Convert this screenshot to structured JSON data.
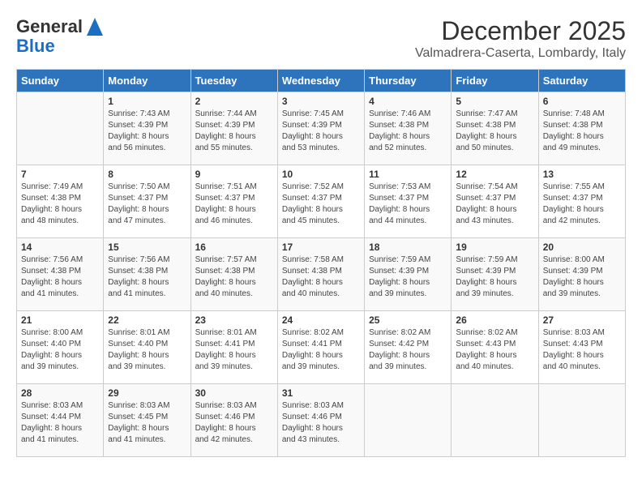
{
  "header": {
    "logo_general": "General",
    "logo_blue": "Blue",
    "month": "December 2025",
    "location": "Valmadrera-Caserta, Lombardy, Italy"
  },
  "days_of_week": [
    "Sunday",
    "Monday",
    "Tuesday",
    "Wednesday",
    "Thursday",
    "Friday",
    "Saturday"
  ],
  "weeks": [
    [
      {
        "day": "",
        "info": ""
      },
      {
        "day": "1",
        "info": "Sunrise: 7:43 AM\nSunset: 4:39 PM\nDaylight: 8 hours\nand 56 minutes."
      },
      {
        "day": "2",
        "info": "Sunrise: 7:44 AM\nSunset: 4:39 PM\nDaylight: 8 hours\nand 55 minutes."
      },
      {
        "day": "3",
        "info": "Sunrise: 7:45 AM\nSunset: 4:39 PM\nDaylight: 8 hours\nand 53 minutes."
      },
      {
        "day": "4",
        "info": "Sunrise: 7:46 AM\nSunset: 4:38 PM\nDaylight: 8 hours\nand 52 minutes."
      },
      {
        "day": "5",
        "info": "Sunrise: 7:47 AM\nSunset: 4:38 PM\nDaylight: 8 hours\nand 50 minutes."
      },
      {
        "day": "6",
        "info": "Sunrise: 7:48 AM\nSunset: 4:38 PM\nDaylight: 8 hours\nand 49 minutes."
      }
    ],
    [
      {
        "day": "7",
        "info": "Sunrise: 7:49 AM\nSunset: 4:38 PM\nDaylight: 8 hours\nand 48 minutes."
      },
      {
        "day": "8",
        "info": "Sunrise: 7:50 AM\nSunset: 4:37 PM\nDaylight: 8 hours\nand 47 minutes."
      },
      {
        "day": "9",
        "info": "Sunrise: 7:51 AM\nSunset: 4:37 PM\nDaylight: 8 hours\nand 46 minutes."
      },
      {
        "day": "10",
        "info": "Sunrise: 7:52 AM\nSunset: 4:37 PM\nDaylight: 8 hours\nand 45 minutes."
      },
      {
        "day": "11",
        "info": "Sunrise: 7:53 AM\nSunset: 4:37 PM\nDaylight: 8 hours\nand 44 minutes."
      },
      {
        "day": "12",
        "info": "Sunrise: 7:54 AM\nSunset: 4:37 PM\nDaylight: 8 hours\nand 43 minutes."
      },
      {
        "day": "13",
        "info": "Sunrise: 7:55 AM\nSunset: 4:37 PM\nDaylight: 8 hours\nand 42 minutes."
      }
    ],
    [
      {
        "day": "14",
        "info": "Sunrise: 7:56 AM\nSunset: 4:38 PM\nDaylight: 8 hours\nand 41 minutes."
      },
      {
        "day": "15",
        "info": "Sunrise: 7:56 AM\nSunset: 4:38 PM\nDaylight: 8 hours\nand 41 minutes."
      },
      {
        "day": "16",
        "info": "Sunrise: 7:57 AM\nSunset: 4:38 PM\nDaylight: 8 hours\nand 40 minutes."
      },
      {
        "day": "17",
        "info": "Sunrise: 7:58 AM\nSunset: 4:38 PM\nDaylight: 8 hours\nand 40 minutes."
      },
      {
        "day": "18",
        "info": "Sunrise: 7:59 AM\nSunset: 4:39 PM\nDaylight: 8 hours\nand 39 minutes."
      },
      {
        "day": "19",
        "info": "Sunrise: 7:59 AM\nSunset: 4:39 PM\nDaylight: 8 hours\nand 39 minutes."
      },
      {
        "day": "20",
        "info": "Sunrise: 8:00 AM\nSunset: 4:39 PM\nDaylight: 8 hours\nand 39 minutes."
      }
    ],
    [
      {
        "day": "21",
        "info": "Sunrise: 8:00 AM\nSunset: 4:40 PM\nDaylight: 8 hours\nand 39 minutes."
      },
      {
        "day": "22",
        "info": "Sunrise: 8:01 AM\nSunset: 4:40 PM\nDaylight: 8 hours\nand 39 minutes."
      },
      {
        "day": "23",
        "info": "Sunrise: 8:01 AM\nSunset: 4:41 PM\nDaylight: 8 hours\nand 39 minutes."
      },
      {
        "day": "24",
        "info": "Sunrise: 8:02 AM\nSunset: 4:41 PM\nDaylight: 8 hours\nand 39 minutes."
      },
      {
        "day": "25",
        "info": "Sunrise: 8:02 AM\nSunset: 4:42 PM\nDaylight: 8 hours\nand 39 minutes."
      },
      {
        "day": "26",
        "info": "Sunrise: 8:02 AM\nSunset: 4:43 PM\nDaylight: 8 hours\nand 40 minutes."
      },
      {
        "day": "27",
        "info": "Sunrise: 8:03 AM\nSunset: 4:43 PM\nDaylight: 8 hours\nand 40 minutes."
      }
    ],
    [
      {
        "day": "28",
        "info": "Sunrise: 8:03 AM\nSunset: 4:44 PM\nDaylight: 8 hours\nand 41 minutes."
      },
      {
        "day": "29",
        "info": "Sunrise: 8:03 AM\nSunset: 4:45 PM\nDaylight: 8 hours\nand 41 minutes."
      },
      {
        "day": "30",
        "info": "Sunrise: 8:03 AM\nSunset: 4:46 PM\nDaylight: 8 hours\nand 42 minutes."
      },
      {
        "day": "31",
        "info": "Sunrise: 8:03 AM\nSunset: 4:46 PM\nDaylight: 8 hours\nand 43 minutes."
      },
      {
        "day": "",
        "info": ""
      },
      {
        "day": "",
        "info": ""
      },
      {
        "day": "",
        "info": ""
      }
    ]
  ]
}
